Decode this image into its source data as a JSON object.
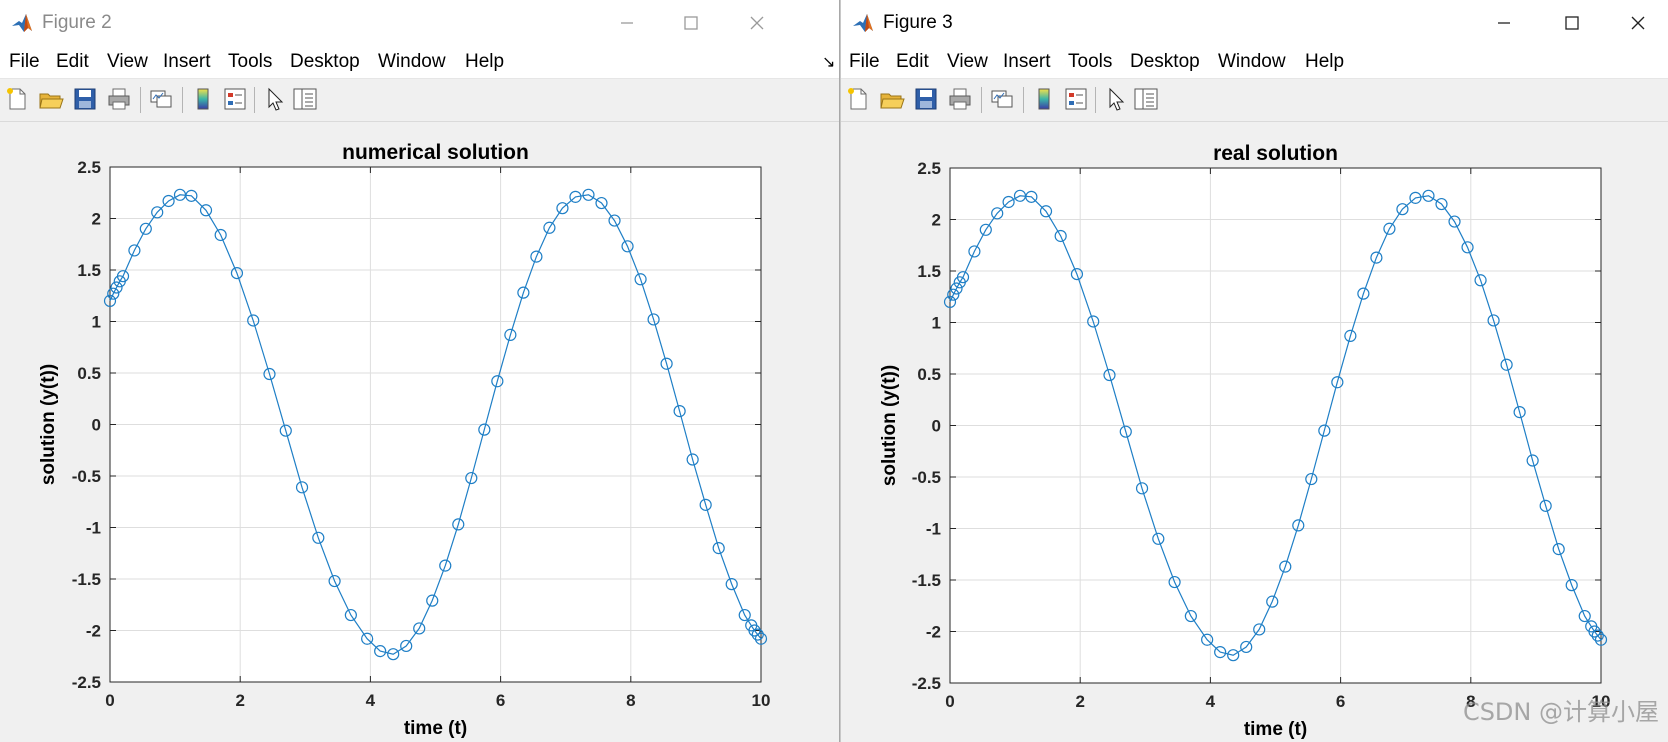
{
  "windows": [
    {
      "title": "Figure 2",
      "menu": [
        "File",
        "Edit",
        "View",
        "Insert",
        "Tools",
        "Desktop",
        "Window",
        "Help"
      ]
    },
    {
      "title": "Figure 3",
      "menu": [
        "File",
        "Edit",
        "View",
        "Insert",
        "Tools",
        "Desktop",
        "Window",
        "Help"
      ]
    }
  ],
  "toolbar_icons": [
    "new-figure-icon",
    "open-file-icon",
    "save-icon",
    "print-icon",
    "link-plot-icon",
    "insert-colorbar-icon",
    "insert-legend-icon",
    "edit-plot-arrow-icon",
    "property-inspector-icon"
  ],
  "overflow_glyph": "↘",
  "colors": {
    "line": "#1f7fc6",
    "grid": "#dedede",
    "axes_bg": "#ffffff",
    "window_bg": "#f0f0f0"
  },
  "watermark": "CSDN @计算小屋",
  "chart_data": [
    {
      "type": "line",
      "title": "numerical solution",
      "xlabel": "time (t)",
      "ylabel": "solution (y(t))",
      "xlim": [
        0,
        10
      ],
      "ylim": [
        -2.5,
        2.5
      ],
      "xticks": [
        "0",
        "2",
        "4",
        "6",
        "8",
        "10"
      ],
      "yticks": [
        "2.5",
        "2",
        "1.5",
        "1",
        "0.5",
        "0",
        "-0.5",
        "-1",
        "-1.5",
        "-2",
        "-2.5"
      ],
      "grid": true,
      "marker": "circle",
      "x": [
        0,
        0.05,
        0.1,
        0.15,
        0.2,
        0.375,
        0.55,
        0.725,
        0.9,
        1.075,
        1.25,
        1.475,
        1.7,
        1.95,
        2.2,
        2.45,
        2.7,
        2.95,
        3.2,
        3.45,
        3.7,
        3.95,
        4.15,
        4.35,
        4.55,
        4.75,
        4.95,
        5.15,
        5.35,
        5.55,
        5.75,
        5.95,
        6.15,
        6.35,
        6.55,
        6.75,
        6.95,
        7.15,
        7.35,
        7.55,
        7.75,
        7.95,
        8.15,
        8.35,
        8.55,
        8.75,
        8.95,
        9.15,
        9.35,
        9.55,
        9.75,
        9.85,
        9.9,
        9.95,
        10
      ],
      "y": [
        1.2,
        1.27,
        1.33,
        1.39,
        1.44,
        1.69,
        1.9,
        2.06,
        2.17,
        2.23,
        2.22,
        2.08,
        1.84,
        1.47,
        1.01,
        0.49,
        -0.06,
        -0.61,
        -1.1,
        -1.52,
        -1.85,
        -2.08,
        -2.2,
        -2.23,
        -2.15,
        -1.98,
        -1.71,
        -1.37,
        -0.97,
        -0.52,
        -0.05,
        0.42,
        0.87,
        1.28,
        1.63,
        1.91,
        2.1,
        2.21,
        2.23,
        2.15,
        1.98,
        1.73,
        1.41,
        1.02,
        0.59,
        0.13,
        -0.34,
        -0.78,
        -1.2,
        -1.55,
        -1.85,
        -1.95,
        -2.0,
        -2.04,
        -2.08
      ]
    },
    {
      "type": "line",
      "title": "real solution",
      "xlabel": "time (t)",
      "ylabel": "solution (y(t))",
      "xlim": [
        0,
        10
      ],
      "ylim": [
        -2.5,
        2.5
      ],
      "xticks": [
        "0",
        "2",
        "4",
        "6",
        "8",
        "10"
      ],
      "yticks": [
        "2.5",
        "2",
        "1.5",
        "1",
        "0.5",
        "0",
        "-0.5",
        "-1",
        "-1.5",
        "-2",
        "-2.5"
      ],
      "grid": true,
      "marker": "circle",
      "x": [
        0,
        0.05,
        0.1,
        0.15,
        0.2,
        0.375,
        0.55,
        0.725,
        0.9,
        1.075,
        1.25,
        1.475,
        1.7,
        1.95,
        2.2,
        2.45,
        2.7,
        2.95,
        3.2,
        3.45,
        3.7,
        3.95,
        4.15,
        4.35,
        4.55,
        4.75,
        4.95,
        5.15,
        5.35,
        5.55,
        5.75,
        5.95,
        6.15,
        6.35,
        6.55,
        6.75,
        6.95,
        7.15,
        7.35,
        7.55,
        7.75,
        7.95,
        8.15,
        8.35,
        8.55,
        8.75,
        8.95,
        9.15,
        9.35,
        9.55,
        9.75,
        9.85,
        9.9,
        9.95,
        10
      ],
      "y": [
        1.2,
        1.27,
        1.33,
        1.39,
        1.44,
        1.69,
        1.9,
        2.06,
        2.17,
        2.23,
        2.22,
        2.08,
        1.84,
        1.47,
        1.01,
        0.49,
        -0.06,
        -0.61,
        -1.1,
        -1.52,
        -1.85,
        -2.08,
        -2.2,
        -2.23,
        -2.15,
        -1.98,
        -1.71,
        -1.37,
        -0.97,
        -0.52,
        -0.05,
        0.42,
        0.87,
        1.28,
        1.63,
        1.91,
        2.1,
        2.21,
        2.23,
        2.15,
        1.98,
        1.73,
        1.41,
        1.02,
        0.59,
        0.13,
        -0.34,
        -0.78,
        -1.2,
        -1.55,
        -1.85,
        -1.95,
        -2.0,
        -2.04,
        -2.08
      ]
    }
  ]
}
